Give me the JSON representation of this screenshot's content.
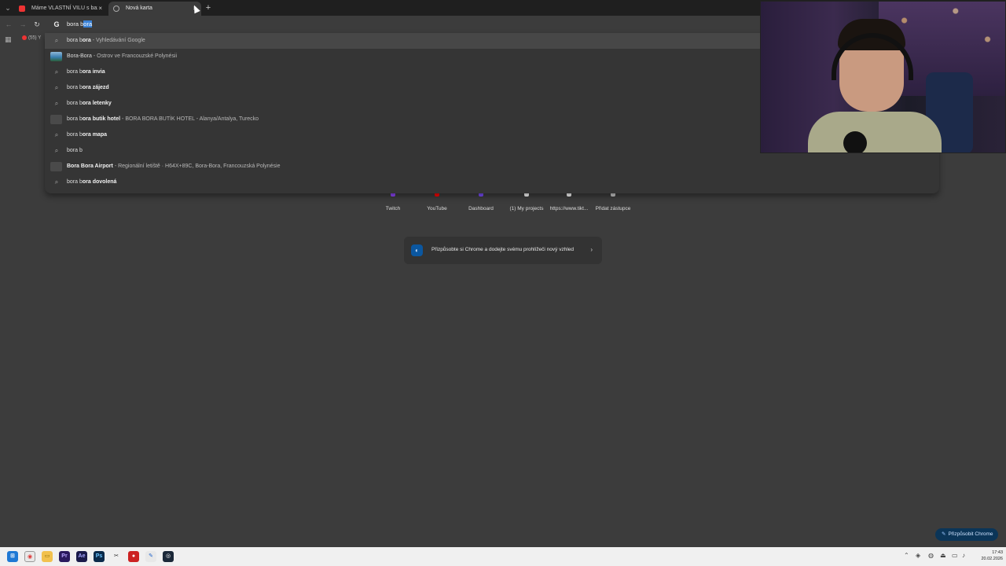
{
  "tabs": [
    {
      "title": "Máme VLASTNÍ VILU s bazénem",
      "favicon": "youtube-icon"
    },
    {
      "title": "Nová karta",
      "favicon": "chrome-icon"
    }
  ],
  "tab_close_glyph": "×",
  "new_tab_glyph": "+",
  "omnibox": {
    "typed": "bora b",
    "autocomplete": "ora"
  },
  "bookmark": {
    "label": "(55) Y"
  },
  "suggestions": [
    {
      "type": "search",
      "prefix": "bora b",
      "bold": "ora",
      "desc": " - Vyhledávání Google",
      "selected": true
    },
    {
      "type": "entity",
      "prefix": "",
      "bold": "Bora-Bora",
      "desc": " - Ostrov ve Francouzské Polynésii",
      "selected": false
    },
    {
      "type": "search",
      "prefix": "bora b",
      "bold": "ora invia",
      "desc": "",
      "selected": false
    },
    {
      "type": "search",
      "prefix": "bora b",
      "bold": "ora zájezd",
      "desc": "",
      "selected": false
    },
    {
      "type": "search",
      "prefix": "bora b",
      "bold": "ora letenky",
      "desc": "",
      "selected": false
    },
    {
      "type": "place",
      "prefix": "bora b",
      "bold": "ora butik hotel",
      "desc": " - BORA BORA BUTİK HOTEL - Alanya/Antalya, Turecko",
      "selected": false
    },
    {
      "type": "search",
      "prefix": "bora b",
      "bold": "ora mapa",
      "desc": "",
      "selected": false
    },
    {
      "type": "search",
      "prefix": "bora b",
      "bold": "",
      "desc": "",
      "selected": false
    },
    {
      "type": "place",
      "prefix": "Bora B",
      "bold": "ora Airport",
      "desc": " - Regionální letiště · H64X+89C, Bora-Bora, Francouzská Polynésie",
      "selected": false
    },
    {
      "type": "search",
      "prefix": "bora b",
      "bold": "ora dovolená",
      "desc": "",
      "selected": false
    }
  ],
  "shortcuts": [
    {
      "label": "Twitch",
      "color": "#9146ff"
    },
    {
      "label": "YouTube",
      "color": "#ff0000"
    },
    {
      "label": "Dashboard",
      "color": "#7b4dff"
    },
    {
      "label": "(1) My projects",
      "color": "#ffffff"
    },
    {
      "label": "https://www.tikt...",
      "color": "#ffffff"
    },
    {
      "label": "Přidat zástupce",
      "color": "#cccccc"
    }
  ],
  "banner": {
    "text": "Přizpůsobte si Chrome a dodejte svému prohlížeči nový vzhled",
    "arrow": "›"
  },
  "customize_button": {
    "label": "Přizpůsobit Chrome"
  },
  "clock": {
    "time": "17:43",
    "date": "20.02.2026"
  },
  "colors": {
    "accent": "#3b82d6",
    "background": "#3c3c3c",
    "dropdown": "#353535"
  }
}
